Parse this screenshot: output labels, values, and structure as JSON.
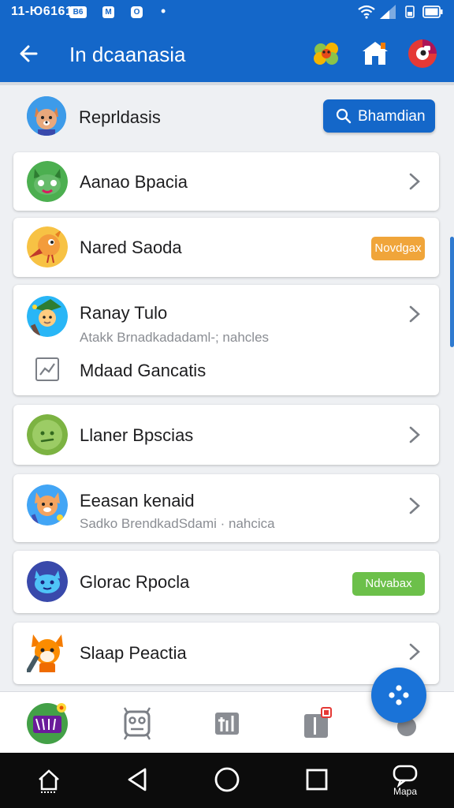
{
  "status_bar": {
    "time": "11-Ю6161",
    "badge_1": "B6",
    "badge_2": "M",
    "badge_3": "O"
  },
  "app_bar": {
    "title": "In dcaanasia"
  },
  "header": {
    "label": "Reprldasis",
    "search_button_label": "Bhamdian"
  },
  "cards": [
    {
      "title": "Aanao Bpacia",
      "trailing": "chevron"
    },
    {
      "title": "Nared Saoda",
      "trailing": "badge",
      "badge": "Novdgax",
      "badge_color": "#f0a53a"
    },
    {
      "title": "Ranay Tulo",
      "subtitle": "Atakk Brnadkadadaml-; nahcles",
      "extra_label": "Mdaad Gancatis",
      "trailing": "chevron"
    },
    {
      "title": "Llaner Bpscias",
      "trailing": "chevron"
    },
    {
      "title": "Eeasan kenaid",
      "subtitle": "Sadko BrendkadSdami · nahcica",
      "trailing": "chevron"
    },
    {
      "title": "Glorac Rpocla",
      "trailing": "badge",
      "badge": "Ndvabax",
      "badge_color": "#6cc04a"
    },
    {
      "title": "Slaap Peactia",
      "trailing": "chevron"
    }
  ],
  "system_nav": {
    "recent_label": "Mapa"
  },
  "colors": {
    "primary": "#1467c9",
    "orange_badge": "#f0a53a",
    "green_badge": "#6cc04a",
    "background": "#eef0f3"
  },
  "icons": {
    "app_bar": [
      "back-arrow-icon",
      "flower-icon",
      "home-icon",
      "profile-icon"
    ],
    "bottom_nav": [
      "home-app-icon",
      "grid-icon",
      "stats-icon",
      "notification-icon"
    ],
    "system_nav": [
      "home-key-icon",
      "back-key-icon",
      "home-circle-icon",
      "recents-square-icon",
      "message-icon"
    ]
  }
}
